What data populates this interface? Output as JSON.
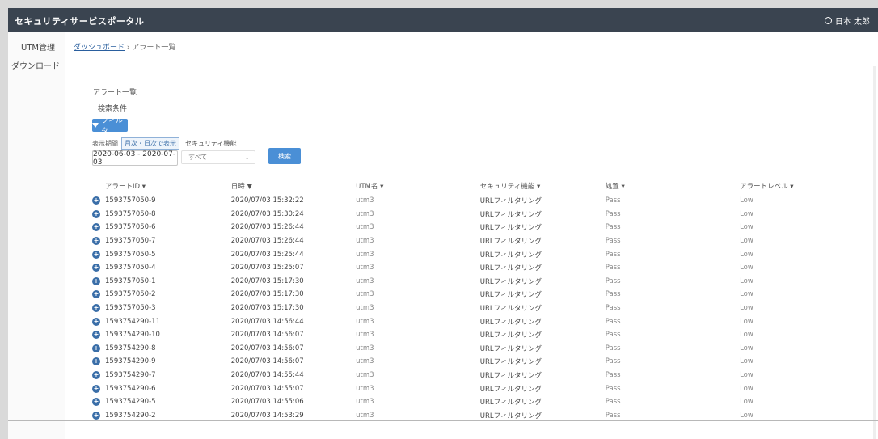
{
  "header": {
    "title": "セキュリティサービスポータル",
    "user_name": "日本 太郎"
  },
  "sidebar": {
    "items": [
      {
        "label": "UTM管理"
      },
      {
        "label": "ダウンロード"
      }
    ]
  },
  "breadcrumb": {
    "link": "ダッシュボード",
    "separator": " › ",
    "current": "アラート一覧"
  },
  "page": {
    "title": "アラート一覧",
    "conditions_label": "検索条件"
  },
  "filter": {
    "button_label": "フィルタ",
    "period_label": "表示期間",
    "period_option": "月次・日次で表示",
    "feature_label": "セキュリティ機能",
    "date_range": "2020-06-03 - 2020-07-03",
    "select_value": "すべて",
    "search_button": "検索"
  },
  "table": {
    "headers": [
      "アラートID ▾",
      "日時 ▼",
      "UTM名 ▾",
      "セキュリティ機能 ▾",
      "処置 ▾",
      "アラートレベル ▾"
    ],
    "rows": [
      [
        "1593757050-9",
        "2020/07/03 15:32:22",
        "utm3",
        "URLフィルタリング",
        "Pass",
        "Low"
      ],
      [
        "1593757050-8",
        "2020/07/03 15:30:24",
        "utm3",
        "URLフィルタリング",
        "Pass",
        "Low"
      ],
      [
        "1593757050-6",
        "2020/07/03 15:26:44",
        "utm3",
        "URLフィルタリング",
        "Pass",
        "Low"
      ],
      [
        "1593757050-7",
        "2020/07/03 15:26:44",
        "utm3",
        "URLフィルタリング",
        "Pass",
        "Low"
      ],
      [
        "1593757050-5",
        "2020/07/03 15:25:44",
        "utm3",
        "URLフィルタリング",
        "Pass",
        "Low"
      ],
      [
        "1593757050-4",
        "2020/07/03 15:25:07",
        "utm3",
        "URLフィルタリング",
        "Pass",
        "Low"
      ],
      [
        "1593757050-1",
        "2020/07/03 15:17:30",
        "utm3",
        "URLフィルタリング",
        "Pass",
        "Low"
      ],
      [
        "1593757050-2",
        "2020/07/03 15:17:30",
        "utm3",
        "URLフィルタリング",
        "Pass",
        "Low"
      ],
      [
        "1593757050-3",
        "2020/07/03 15:17:30",
        "utm3",
        "URLフィルタリング",
        "Pass",
        "Low"
      ],
      [
        "1593754290-11",
        "2020/07/03 14:56:44",
        "utm3",
        "URLフィルタリング",
        "Pass",
        "Low"
      ],
      [
        "1593754290-10",
        "2020/07/03 14:56:07",
        "utm3",
        "URLフィルタリング",
        "Pass",
        "Low"
      ],
      [
        "1593754290-8",
        "2020/07/03 14:56:07",
        "utm3",
        "URLフィルタリング",
        "Pass",
        "Low"
      ],
      [
        "1593754290-9",
        "2020/07/03 14:56:07",
        "utm3",
        "URLフィルタリング",
        "Pass",
        "Low"
      ],
      [
        "1593754290-7",
        "2020/07/03 14:55:44",
        "utm3",
        "URLフィルタリング",
        "Pass",
        "Low"
      ],
      [
        "1593754290-6",
        "2020/07/03 14:55:07",
        "utm3",
        "URLフィルタリング",
        "Pass",
        "Low"
      ],
      [
        "1593754290-5",
        "2020/07/03 14:55:06",
        "utm3",
        "URLフィルタリング",
        "Pass",
        "Low"
      ],
      [
        "1593754290-2",
        "2020/07/03 14:53:29",
        "utm3",
        "URLフィルタリング",
        "Pass",
        "Low"
      ]
    ]
  },
  "colors": {
    "topbar": "#3a4450",
    "accent": "#4a8fd6",
    "link": "#2a5f9e"
  }
}
